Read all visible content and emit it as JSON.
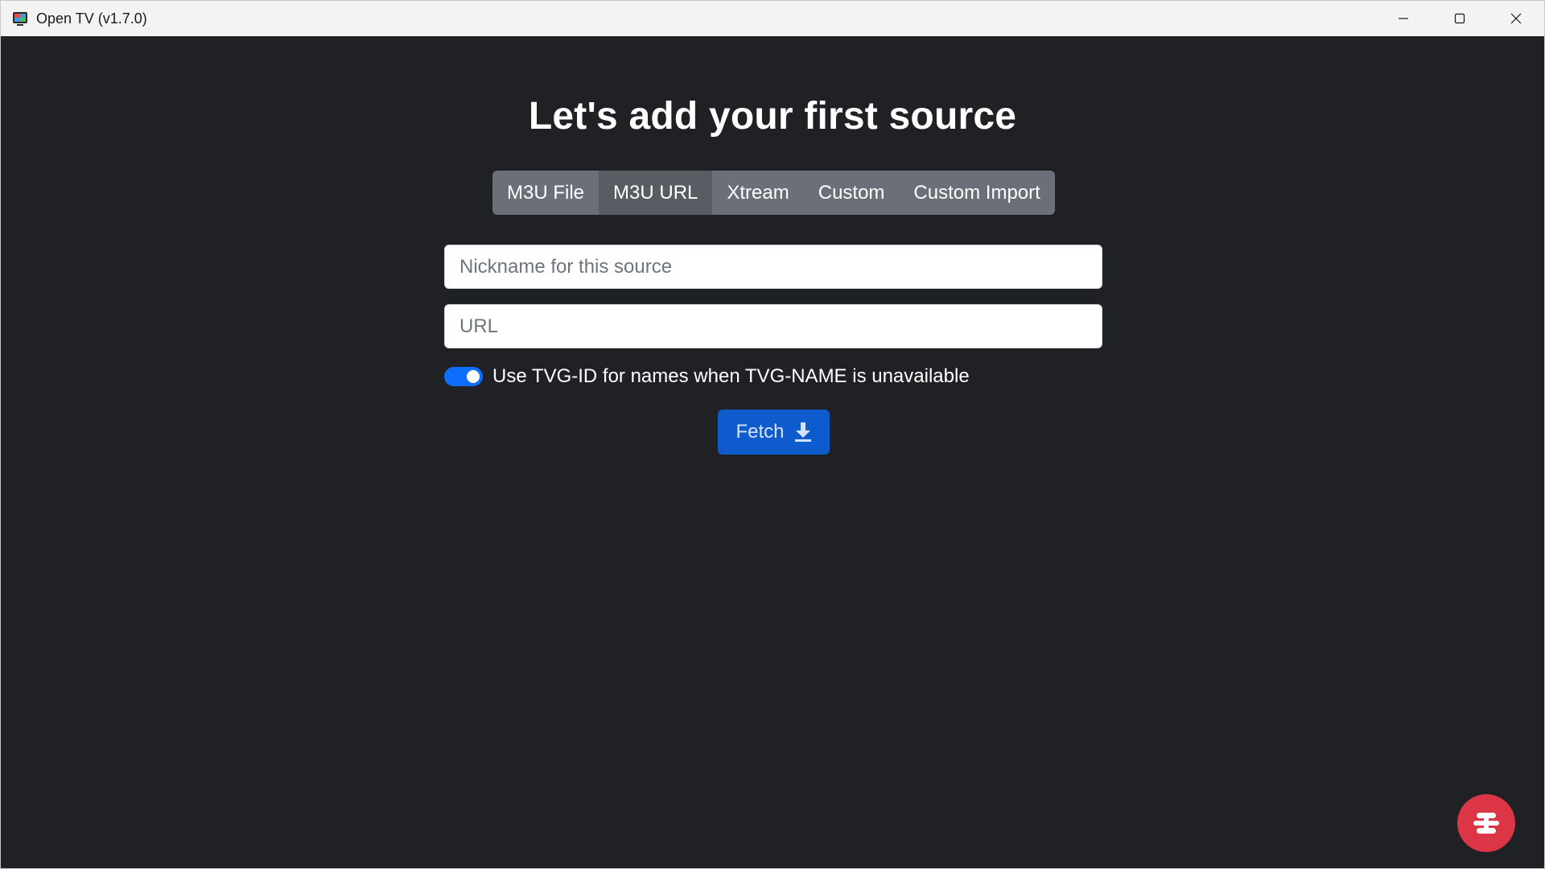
{
  "window": {
    "title": "Open TV (v1.7.0)",
    "icon": "tv-app-icon",
    "controls": [
      "minimize-icon",
      "maximize-icon",
      "close-icon"
    ]
  },
  "main": {
    "heading": "Let's add your first source",
    "tabs": [
      {
        "label": "M3U File",
        "active": false
      },
      {
        "label": "M3U URL",
        "active": true
      },
      {
        "label": "Xtream",
        "active": false
      },
      {
        "label": "Custom",
        "active": false
      },
      {
        "label": "Custom Import",
        "active": false
      }
    ],
    "nickname": {
      "placeholder": "Nickname for this source",
      "value": ""
    },
    "url": {
      "placeholder": "URL",
      "value": ""
    },
    "toggle": {
      "label": "Use TVG-ID for names when TVG-NAME is unavailable",
      "checked": true
    },
    "fetch": {
      "label": "Fetch",
      "icon": "download-icon"
    }
  },
  "fab": {
    "icon": "menu-icon"
  },
  "colors": {
    "background": "#202125",
    "tab_group": "#6b7078",
    "tab_active": "#585d64",
    "primary": "#0d6efd",
    "fetch_button": "#0d5bcc",
    "fab": "#dc3545"
  }
}
